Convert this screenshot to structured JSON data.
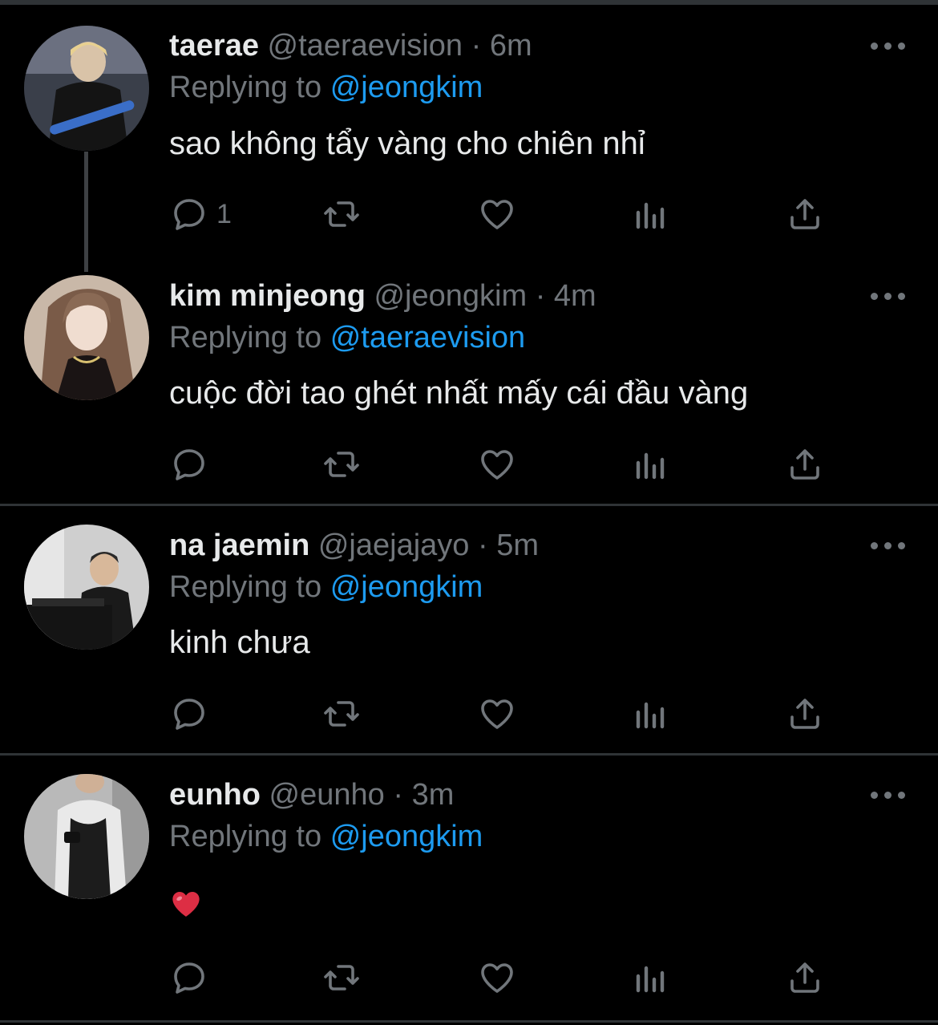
{
  "colors": {
    "background": "#000000",
    "text": "#e7e9ea",
    "muted": "#71767b",
    "link": "#1d9bf0",
    "divider": "#2f3336"
  },
  "tweets": [
    {
      "name": "taerae",
      "handle": "@taeraevision",
      "dot": "·",
      "time": "6m",
      "replying_label": "Replying to",
      "replying_handle": "@jeongkim",
      "text": "sao không tẩy vàng cho chiên nhỉ",
      "reply_count": "1"
    },
    {
      "name": "kim minjeong",
      "handle": "@jeongkim",
      "dot": "·",
      "time": "4m",
      "replying_label": "Replying to",
      "replying_handle": "@taeraevision",
      "text": "cuộc đời tao ghét nhất mấy cái đầu vàng",
      "reply_count": ""
    },
    {
      "name": "na jaemin",
      "handle": "@jaejajayo",
      "dot": "·",
      "time": "5m",
      "replying_label": "Replying to",
      "replying_handle": "@jeongkim",
      "text": "kinh chưa",
      "reply_count": ""
    },
    {
      "name": "eunho",
      "handle": "@eunho",
      "dot": "·",
      "time": "3m",
      "replying_label": "Replying to",
      "replying_handle": "@jeongkim",
      "text": "",
      "emoji": "red-heart-emoji",
      "reply_count": ""
    }
  ],
  "icons": {
    "reply": "reply-icon",
    "retweet": "retweet-icon",
    "like": "heart-icon",
    "views": "views-icon",
    "share": "share-icon",
    "more": "more-icon"
  }
}
